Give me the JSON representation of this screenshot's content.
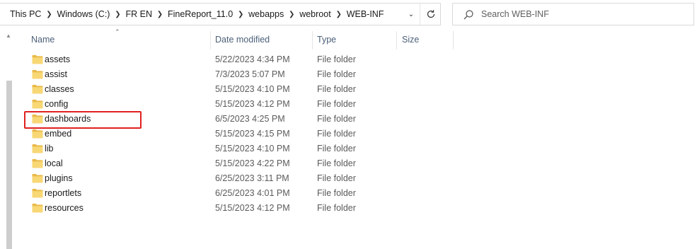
{
  "breadcrumb": [
    "This PC",
    "Windows (C:)",
    "FR EN",
    "FineReport_11.0",
    "webapps",
    "webroot",
    "WEB-INF"
  ],
  "search": {
    "placeholder": "Search WEB-INF"
  },
  "columns": {
    "name": "Name",
    "date": "Date modified",
    "type": "Type",
    "size": "Size"
  },
  "files": [
    {
      "name": "assets",
      "date": "5/22/2023 4:34 PM",
      "type": "File folder"
    },
    {
      "name": "assist",
      "date": "7/3/2023 5:07 PM",
      "type": "File folder"
    },
    {
      "name": "classes",
      "date": "5/15/2023 4:10 PM",
      "type": "File folder"
    },
    {
      "name": "config",
      "date": "5/15/2023 4:12 PM",
      "type": "File folder"
    },
    {
      "name": "dashboards",
      "date": "6/5/2023 4:25 PM",
      "type": "File folder"
    },
    {
      "name": "embed",
      "date": "5/15/2023 4:15 PM",
      "type": "File folder"
    },
    {
      "name": "lib",
      "date": "5/15/2023 4:10 PM",
      "type": "File folder"
    },
    {
      "name": "local",
      "date": "5/15/2023 4:22 PM",
      "type": "File folder"
    },
    {
      "name": "plugins",
      "date": "6/25/2023 3:11 PM",
      "type": "File folder"
    },
    {
      "name": "reportlets",
      "date": "6/25/2023 4:01 PM",
      "type": "File folder"
    },
    {
      "name": "resources",
      "date": "5/15/2023 4:12 PM",
      "type": "File folder"
    }
  ],
  "colors": {
    "folder": "#f8d775",
    "folder_dark": "#e9b949",
    "highlight": "#e02020"
  }
}
